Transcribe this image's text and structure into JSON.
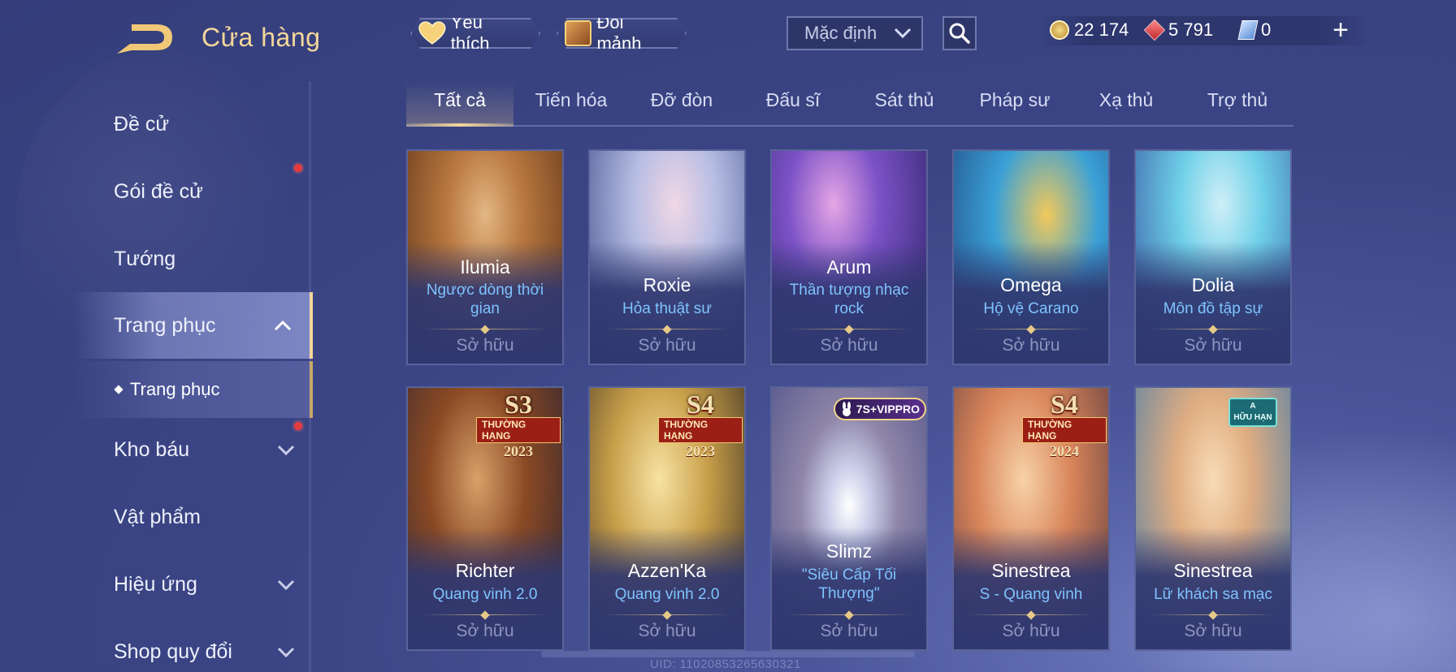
{
  "header": {
    "title": "Cửa hàng",
    "favorite_label": "Yêu thích",
    "exchange_label": "Đổi mảnh",
    "sort": {
      "selected": "Mặc định"
    },
    "currencies": [
      {
        "icon": "gold-coin-icon",
        "value": "22 174"
      },
      {
        "icon": "ruby-icon",
        "value": "5 791"
      },
      {
        "icon": "voucher-icon",
        "value": "0"
      }
    ],
    "add_label": "+"
  },
  "sidebar": {
    "items": [
      {
        "label": "Đề cử"
      },
      {
        "label": "Gói đề cử",
        "dot": true
      },
      {
        "label": "Tướng"
      },
      {
        "label": "Trang phục",
        "active": true,
        "expanded": true
      },
      {
        "label": "Kho báu",
        "dot": true,
        "chevron": "down"
      },
      {
        "label": "Vật phẩm"
      },
      {
        "label": "Hiệu ứng",
        "chevron": "down"
      },
      {
        "label": "Shop quy đổi",
        "chevron": "down"
      }
    ],
    "sub_items": [
      {
        "label": "Trang phục"
      }
    ]
  },
  "tabs": [
    {
      "label": "Tất cả",
      "active": true
    },
    {
      "label": "Tiến hóa"
    },
    {
      "label": "Đỡ đòn"
    },
    {
      "label": "Đấu sĩ"
    },
    {
      "label": "Sát thủ"
    },
    {
      "label": "Pháp sư"
    },
    {
      "label": "Xạ thủ"
    },
    {
      "label": "Trợ thủ"
    }
  ],
  "cards": [
    {
      "hero": "Ilumia",
      "skin": "Ngược dòng thời gian",
      "status": "Sở hữu",
      "palette": [
        "#c98b46",
        "#6d3c1e"
      ]
    },
    {
      "hero": "Roxie",
      "skin": "Hỏa thuật sư",
      "status": "Sở hữu",
      "palette": [
        "#c7d4f2",
        "#3e4b86"
      ]
    },
    {
      "hero": "Arum",
      "skin": "Thần tượng nhạc rock",
      "status": "Sở hữu",
      "palette": [
        "#7d55c9",
        "#2d2669"
      ]
    },
    {
      "hero": "Omega",
      "skin": "Hộ vệ Carano",
      "status": "Sở hữu",
      "palette": [
        "#3aa0d6",
        "#b07a1c"
      ]
    },
    {
      "hero": "Dolia",
      "skin": "Môn đồ tập sự",
      "status": "Sở hữu",
      "palette": [
        "#6fd0e8",
        "#3a6ec2"
      ]
    },
    {
      "hero": "Richter",
      "skin": "Quang vinh 2.0",
      "status": "Sở hữu",
      "palette": [
        "#b0622a",
        "#3b2a22"
      ],
      "badge": {
        "season": "S3",
        "rank": "THƯỜNG HẠNG",
        "year": "2023"
      }
    },
    {
      "hero": "Azzen'Ka",
      "skin": "Quang vinh 2.0",
      "status": "Sở hữu",
      "palette": [
        "#e7c46a",
        "#4a3a1e"
      ],
      "badge": {
        "season": "S4",
        "rank": "THƯỜNG HẠNG",
        "year": "2023"
      }
    },
    {
      "hero": "Slimz",
      "skin": "\"Siêu Cấp Tối Thượng\"",
      "status": "Sở hữu",
      "palette": [
        "#9aa3c7",
        "#6a6a9a"
      ],
      "vip": "7S+VIPPRO"
    },
    {
      "hero": "Sinestrea",
      "skin": "S - Quang vinh",
      "status": "Sở hữu",
      "palette": [
        "#e7a877",
        "#6e3f2e"
      ],
      "badge": {
        "season": "S4",
        "rank": "THƯỜNG HẠNG",
        "year": "2024"
      }
    },
    {
      "hero": "Sinestrea",
      "skin": "Lữ khách sa mạc",
      "status": "Sở hữu",
      "palette": [
        "#e9b98d",
        "#5a8fb0"
      ],
      "limited": {
        "rank": "A",
        "text": "HỮU HẠN"
      }
    }
  ],
  "footer": {
    "uid": "UID: 11020853265630321"
  },
  "colors": {
    "accent": "#f4d79a",
    "skin_name": "#7fc3ff",
    "owned": "#8e95bf",
    "notification": "#e63a3a"
  }
}
